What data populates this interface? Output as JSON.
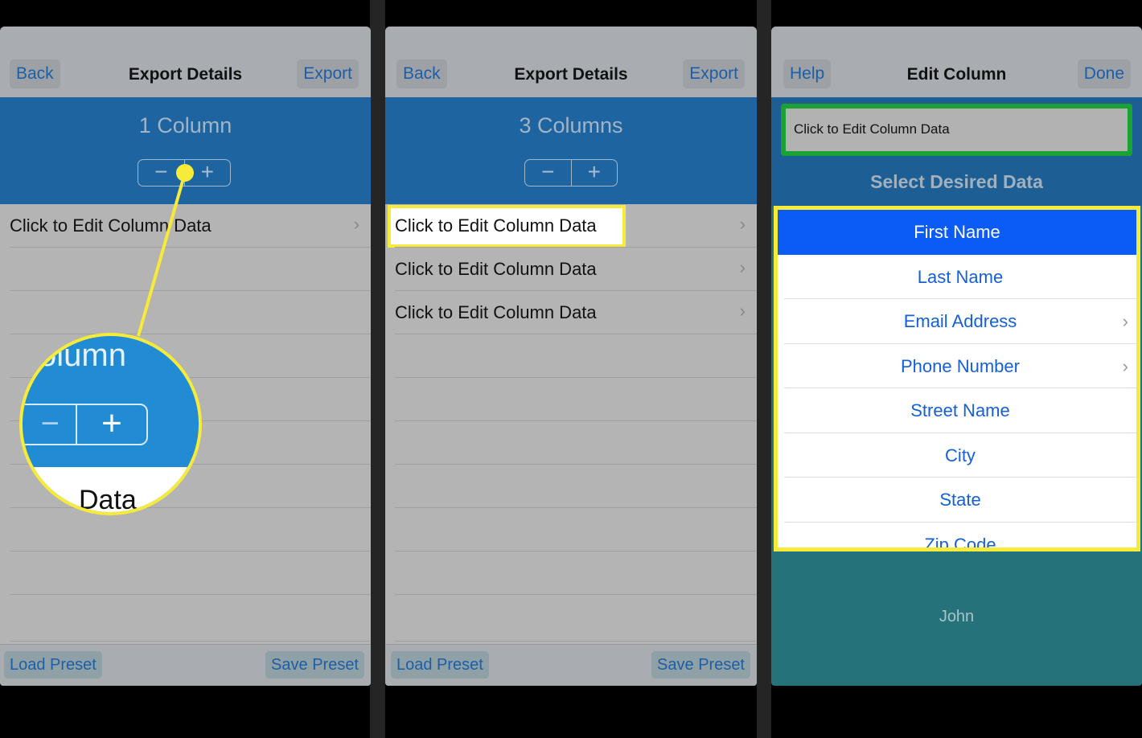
{
  "panels": [
    {
      "nav": {
        "back": "Back",
        "title": "Export Details",
        "export": "Export"
      },
      "count": "1 Column",
      "stepper": {
        "minus": "−",
        "plus": "+"
      },
      "rows": [
        "Click to Edit Column Data"
      ],
      "toolbar": {
        "load": "Load Preset",
        "save": "Save Preset"
      },
      "magnifier": {
        "text_top": "olumn",
        "text_bottom": "Data",
        "minus": "−",
        "plus": "+"
      }
    },
    {
      "nav": {
        "back": "Back",
        "title": "Export Details",
        "export": "Export"
      },
      "count": "3 Columns",
      "stepper": {
        "minus": "−",
        "plus": "+"
      },
      "rows": [
        "Click to Edit Column Data",
        "Click to Edit Column Data",
        "Click to Edit Column Data"
      ],
      "toolbar": {
        "load": "Load Preset",
        "save": "Save Preset"
      }
    },
    {
      "nav": {
        "help": "Help",
        "title": "Edit Column",
        "done": "Done"
      },
      "field": "Click to Edit Column Data",
      "subtitle": "Select Desired Data",
      "options": [
        {
          "label": "First Name",
          "selected": true
        },
        {
          "label": "Last Name"
        },
        {
          "label": "Email Address",
          "chevron": true
        },
        {
          "label": "Phone Number",
          "chevron": true
        },
        {
          "label": "Street Name"
        },
        {
          "label": "City"
        },
        {
          "label": "State"
        },
        {
          "label": "Zip Code"
        }
      ],
      "preview": "John"
    }
  ],
  "colors": {
    "highlight": "#f6ea3a",
    "field_border": "#1aa334",
    "selected": "#0b5cf7",
    "header_blue": "#1d64a0",
    "preview_teal": "#26727a"
  }
}
